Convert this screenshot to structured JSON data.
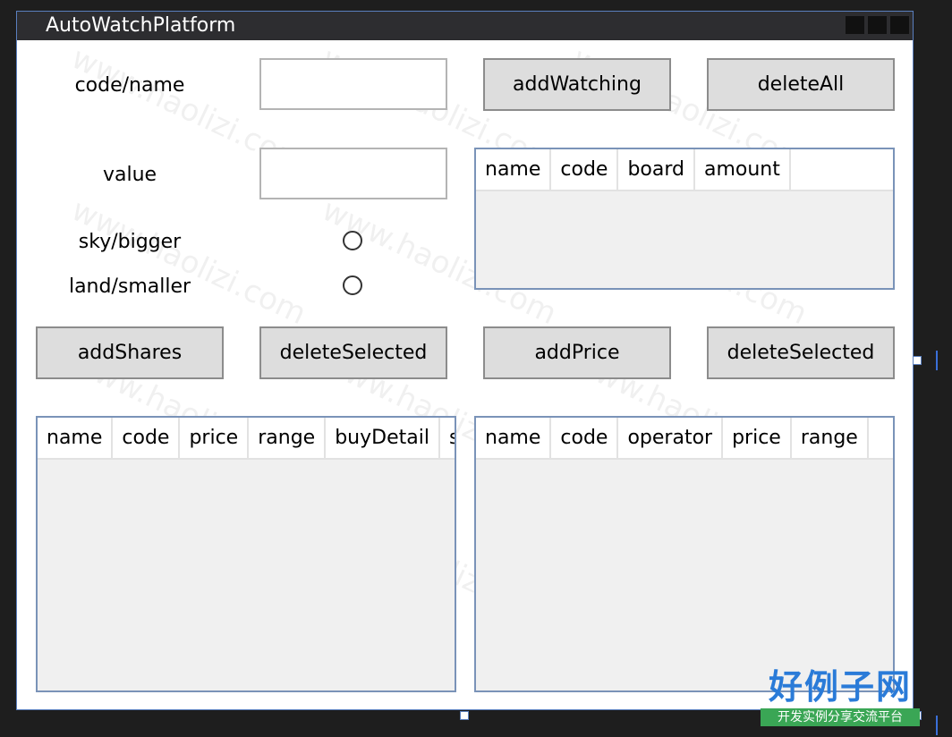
{
  "window": {
    "title": "AutoWatchPlatform"
  },
  "form": {
    "code_label": "code/name",
    "value_label": "value",
    "sky_label": "sky/bigger",
    "land_label": "land/smaller",
    "code_value": "",
    "value_value": ""
  },
  "buttons": {
    "add_watching": "addWatching",
    "delete_all": "deleteAll",
    "add_shares": "addShares",
    "delete_selected_left": "deleteSelected",
    "add_price": "addPrice",
    "delete_selected_right": "deleteSelected"
  },
  "watch_grid": {
    "columns": [
      "name",
      "code",
      "board",
      "amount"
    ]
  },
  "shares_grid": {
    "columns": [
      "name",
      "code",
      "price",
      "range",
      "buyDetail",
      "s"
    ]
  },
  "price_grid": {
    "columns": [
      "name",
      "code",
      "operator",
      "price",
      "range"
    ]
  },
  "watermark": {
    "text": "www.haolizi.com"
  },
  "logo": {
    "title": "好例子网",
    "subtitle": "开发实例分享交流平台"
  },
  "colors": {
    "titlebar": "#2d2d30",
    "button": "#dddddd",
    "grid_bg": "#f0f0f0",
    "border": "#5a7fbf"
  }
}
